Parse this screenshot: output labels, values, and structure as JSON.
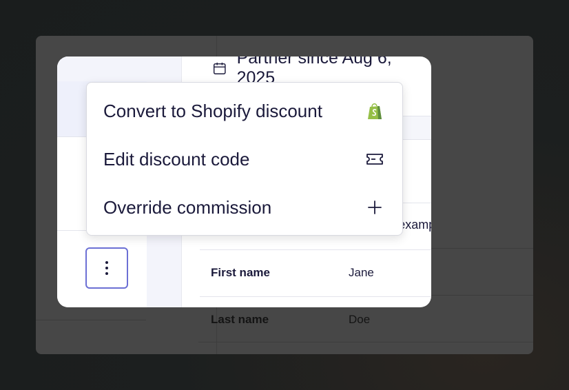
{
  "header": {
    "partner_since": "Partner since Aug 6, 2025"
  },
  "details": {
    "email_fragment": "@example.com",
    "rows": [
      {
        "key": "First name",
        "value": "Jane"
      },
      {
        "key": "Last name",
        "value": "Doe"
      }
    ]
  },
  "menu": {
    "items": [
      {
        "label": "Convert to Shopify discount",
        "icon": "shopify-bag-icon"
      },
      {
        "label": "Edit discount code",
        "icon": "ticket-icon"
      },
      {
        "label": "Override commission",
        "icon": "plus-icon"
      }
    ]
  },
  "colors": {
    "accent": "#6b6fd4",
    "shopify_green": "#95bf47",
    "text": "#1b1a3b"
  }
}
